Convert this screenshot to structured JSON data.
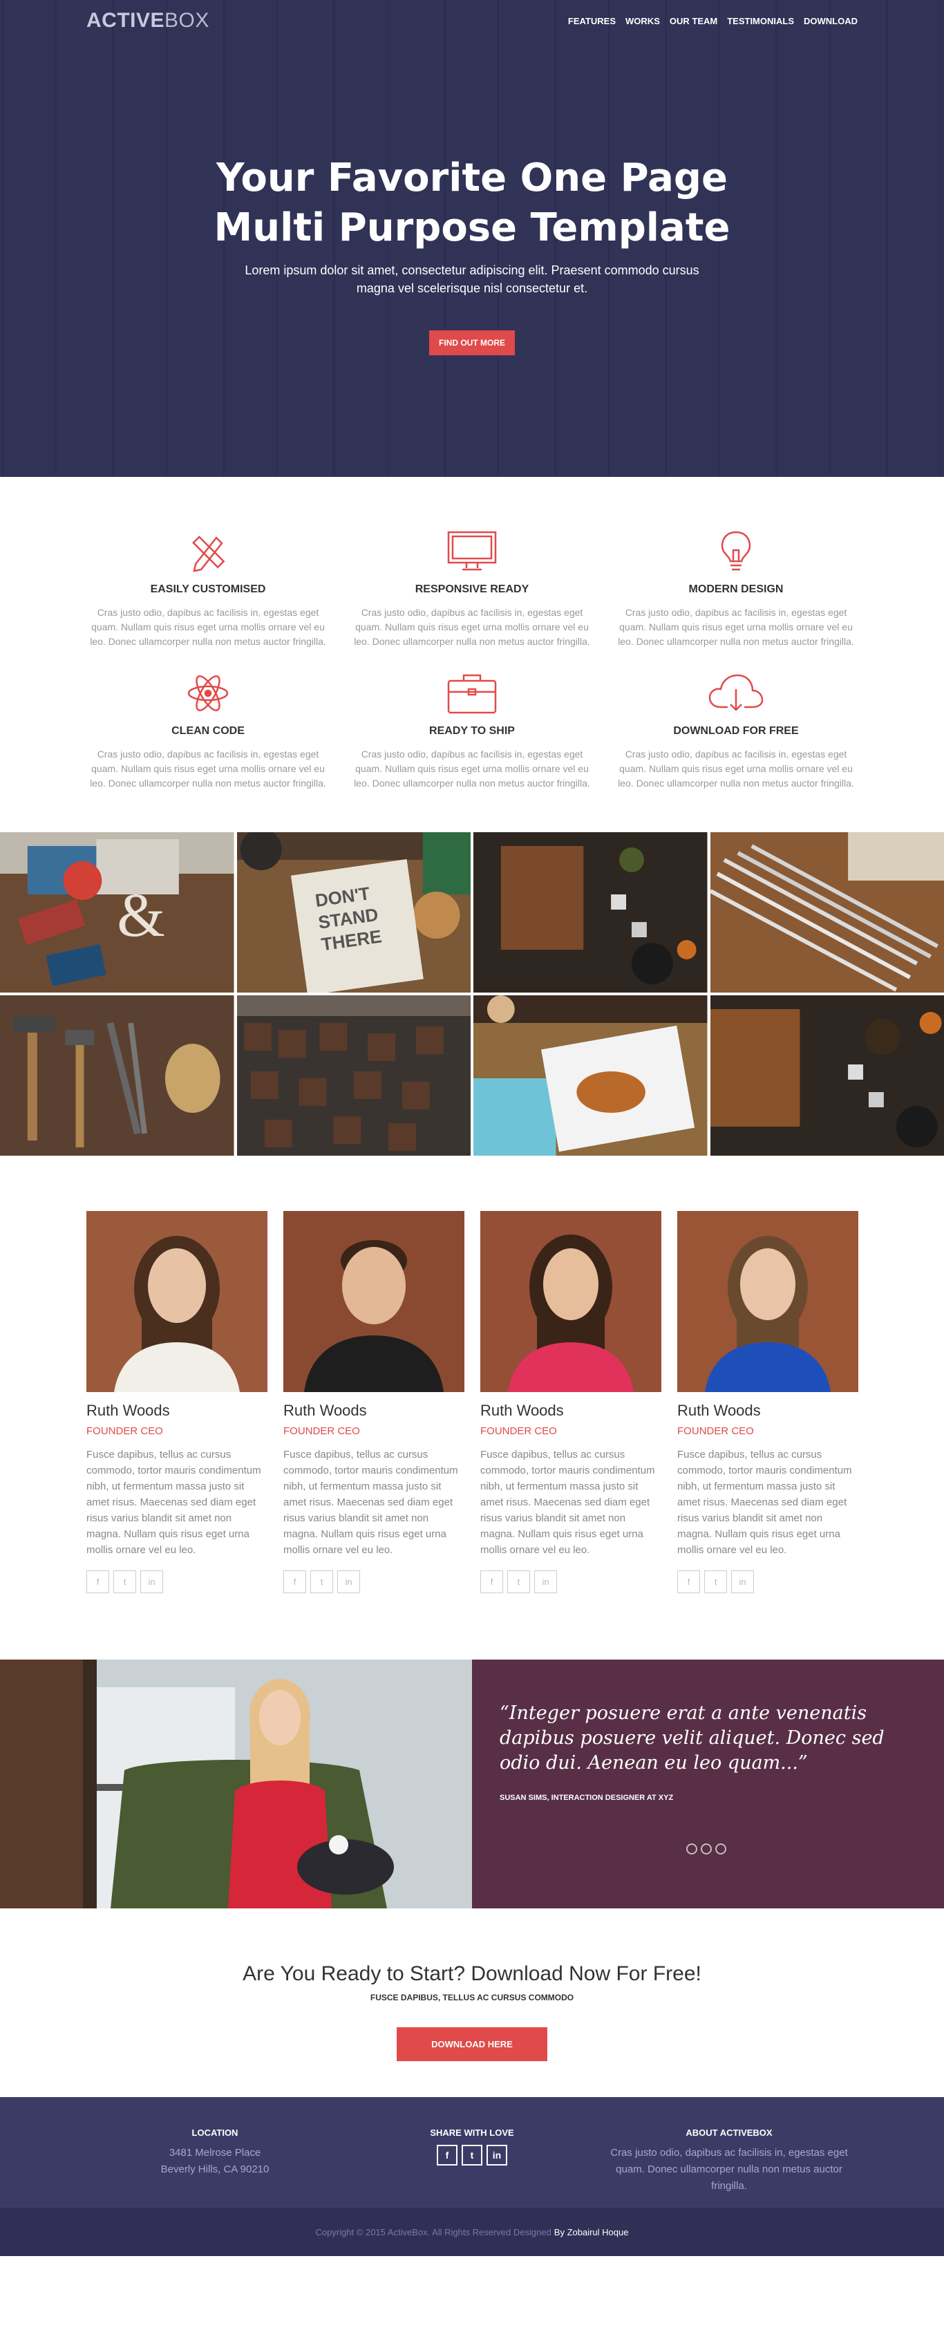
{
  "brand": {
    "bold": "ACTIVE",
    "light": "BOX"
  },
  "nav": {
    "items": [
      "FEATURES",
      "WORKS",
      "OUR TEAM",
      "TESTIMONIALS",
      "DOWNLOAD"
    ]
  },
  "hero": {
    "title_line1": "Your Favorite One Page",
    "title_line2": "Multi Purpose Template",
    "subtitle": "Lorem ipsum dolor sit amet, consectetur adipiscing elit. Praesent commodo cursus magna vel scelerisque nisl consectetur et.",
    "button": "FIND OUT MORE"
  },
  "features": [
    {
      "icon": "pencil-ruler-icon",
      "title": "EASILY CUSTOMISED",
      "text": "Cras justo odio, dapibus ac facilisis in, egestas eget quam. Nullam quis risus eget urna mollis ornare vel eu leo. Donec ullamcorper nulla non metus auctor fringilla."
    },
    {
      "icon": "monitor-icon",
      "title": "RESPONSIVE READY",
      "text": "Cras justo odio, dapibus ac facilisis in, egestas eget quam. Nullam quis risus eget urna mollis ornare vel eu leo. Donec ullamcorper nulla non metus auctor fringilla."
    },
    {
      "icon": "lightbulb-icon",
      "title": "MODERN DESIGN",
      "text": "Cras justo odio, dapibus ac facilisis in, egestas eget quam. Nullam quis risus eget urna mollis ornare vel eu leo. Donec ullamcorper nulla non metus auctor fringilla."
    },
    {
      "icon": "atom-icon",
      "title": "CLEAN CODE",
      "text": "Cras justo odio, dapibus ac facilisis in, egestas eget quam. Nullam quis risus eget urna mollis ornare vel eu leo. Donec ullamcorper nulla non metus auctor fringilla."
    },
    {
      "icon": "briefcase-icon",
      "title": "READY TO SHIP",
      "text": "Cras justo odio, dapibus ac facilisis in, egestas eget quam. Nullam quis risus eget urna mollis ornare vel eu leo. Donec ullamcorper nulla non metus auctor fringilla."
    },
    {
      "icon": "cloud-download-icon",
      "title": "DOWNLOAD FOR FREE",
      "text": "Cras justo odio, dapibus ac facilisis in, egestas eget quam. Nullam quis risus eget urna mollis ornare vel eu leo. Donec ullamcorper nulla non metus auctor fringilla."
    }
  ],
  "works": {
    "sign_text_1": "DON'T",
    "sign_text_2": "STAND",
    "sign_text_3": "THERE"
  },
  "team": [
    {
      "name": "Ruth Woods",
      "role": "FOUNDER CEO",
      "bio": "Fusce dapibus, tellus ac cursus commodo, tortor mauris condimentum nibh, ut fermentum massa justo sit amet risus. Maecenas sed diam eget risus varius blandit sit amet non magna. Nullam quis risus eget urna mollis ornare vel eu leo."
    },
    {
      "name": "Ruth Woods",
      "role": "FOUNDER CEO",
      "bio": "Fusce dapibus, tellus ac cursus commodo, tortor mauris condimentum nibh, ut fermentum massa justo sit amet risus. Maecenas sed diam eget risus varius blandit sit amet non magna. Nullam quis risus eget urna mollis ornare vel eu leo."
    },
    {
      "name": "Ruth Woods",
      "role": "FOUNDER CEO",
      "bio": "Fusce dapibus, tellus ac cursus commodo, tortor mauris condimentum nibh, ut fermentum massa justo sit amet risus. Maecenas sed diam eget risus varius blandit sit amet non magna. Nullam quis risus eget urna mollis ornare vel eu leo."
    },
    {
      "name": "Ruth Woods",
      "role": "FOUNDER CEO",
      "bio": "Fusce dapibus, tellus ac cursus commodo, tortor mauris condimentum nibh, ut fermentum massa justo sit amet risus. Maecenas sed diam eget risus varius blandit sit amet non magna. Nullam quis risus eget urna mollis ornare vel eu leo."
    }
  ],
  "social_glyphs": {
    "facebook": "f",
    "twitter": "t",
    "linkedin": "in"
  },
  "testimonial": {
    "quote": "“Integer posuere erat a ante venenatis dapibus posuere velit aliquet. Donec sed odio dui. Aenean eu leo quam...”",
    "author": "SUSAN SIMS, INTERACTION DESIGNER AT XYZ"
  },
  "cta": {
    "title": "Are You Ready to Start? Download Now For Free!",
    "subtitle": "FUSCE DAPIBUS, TELLUS AC CURSUS COMMODO",
    "button": "DOWNLOAD HERE"
  },
  "footer": {
    "location_title": "LOCATION",
    "address1": "3481 Melrose Place",
    "address2": "Beverly Hills, CA 90210",
    "share_title": "SHARE WITH LOVE",
    "about_title": "ABOUT ACTIVEBOX",
    "about_text": "Cras justo odio, dapibus ac facilisis in, egestas eget quam. Donec ullamcorper nulla non metus auctor fringilla."
  },
  "copyright": {
    "text": "Copyright © 2015 ActiveBox. All Rights Reserved Designed",
    "designer": "By Zobairul Hoque"
  },
  "colors": {
    "accent": "#e14a4a",
    "hero": "#2e3054",
    "testimonial": "#582f46",
    "footer": "#3b3c66"
  }
}
